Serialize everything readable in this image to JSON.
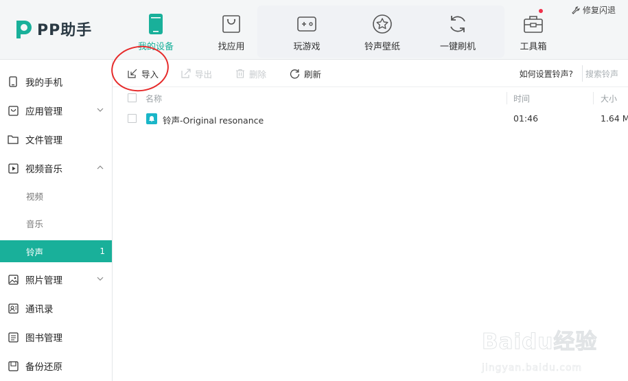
{
  "app": {
    "logo_text": "PP助手",
    "fix_crash": "修复闪退"
  },
  "nav": [
    {
      "label": "我的设备",
      "icon": "phone-icon"
    },
    {
      "label": "找应用",
      "icon": "shopping-bag-icon"
    },
    {
      "label": "玩游戏",
      "icon": "gamepad-icon"
    },
    {
      "label": "铃声壁纸",
      "icon": "star-icon"
    },
    {
      "label": "一键刷机",
      "icon": "refresh-icon"
    },
    {
      "label": "工具箱",
      "icon": "toolbox-icon"
    }
  ],
  "sidebar": {
    "items": [
      {
        "label": "我的手机",
        "icon": "phone-icon"
      },
      {
        "label": "应用管理",
        "icon": "bag-icon"
      },
      {
        "label": "文件管理",
        "icon": "folder-icon"
      },
      {
        "label": "视频音乐",
        "icon": "play-icon"
      },
      {
        "label": "照片管理",
        "icon": "image-icon"
      },
      {
        "label": "通讯录",
        "icon": "contacts-icon"
      },
      {
        "label": "图书管理",
        "icon": "book-icon"
      },
      {
        "label": "备份还原",
        "icon": "backup-icon"
      }
    ],
    "subitems": [
      {
        "label": "视频"
      },
      {
        "label": "音乐"
      },
      {
        "label": "铃声",
        "count": "1"
      }
    ]
  },
  "toolbar": {
    "import_label": "导入",
    "export_label": "导出",
    "delete_label": "删除",
    "refresh_label": "刷新",
    "help_link": "如何设置铃声?",
    "search_placeholder": "搜索铃声"
  },
  "table": {
    "headers": [
      "名称",
      "时间",
      "大小"
    ],
    "rows": [
      {
        "name": "铃声-Original resonance",
        "time": "01:46",
        "size": "1.64 M"
      }
    ]
  },
  "watermark": {
    "big": "Baidu经验",
    "small": "jingyan.baidu.com"
  },
  "colors": {
    "accent": "#19b09a",
    "annotation": "#e62a2a"
  }
}
